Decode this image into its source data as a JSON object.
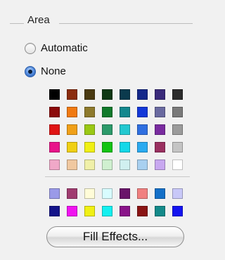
{
  "group": {
    "title": "Area"
  },
  "fill_type": {
    "options": [
      {
        "label": "Automatic",
        "selected": false
      },
      {
        "label": "None",
        "selected": true
      }
    ]
  },
  "palette": {
    "standard_rows": [
      [
        "#000000",
        "#8b2c0f",
        "#4a3a11",
        "#0e3814",
        "#0b3a4d",
        "#14288a",
        "#3a2a7a",
        "#2b2b2b"
      ],
      [
        "#8c0b0b",
        "#f07a12",
        "#8e7a2c",
        "#127a2c",
        "#14888e",
        "#1338d8",
        "#6a6aa0",
        "#7a7a7a"
      ],
      [
        "#e01414",
        "#f0a018",
        "#9ac814",
        "#2c9a6a",
        "#22c8d0",
        "#2f6fe0",
        "#7a2ca0",
        "#9b9b9b"
      ],
      [
        "#e8148a",
        "#f0d014",
        "#f0f014",
        "#14c414",
        "#14d8e8",
        "#2aaaf0",
        "#9a3060",
        "#c4c4c4"
      ],
      [
        "#f0a8c8",
        "#f0c8a0",
        "#f0f0a8",
        "#d0f0d0",
        "#d0f0f0",
        "#a8d0f0",
        "#c8a8f0",
        "#ffffff"
      ]
    ],
    "chart_rows": [
      [
        "#9a9ae8",
        "#a03c70",
        "#fffcd8",
        "#d8fcff",
        "#6a146a",
        "#f08080",
        "#1470c8",
        "#c8c8f8"
      ],
      [
        "#14148a",
        "#f014f0",
        "#f0f014",
        "#14f0f0",
        "#8a148a",
        "#8a1414",
        "#148a8a",
        "#1414f0"
      ]
    ]
  },
  "fill_effects_button": {
    "label": "Fill Effects..."
  }
}
